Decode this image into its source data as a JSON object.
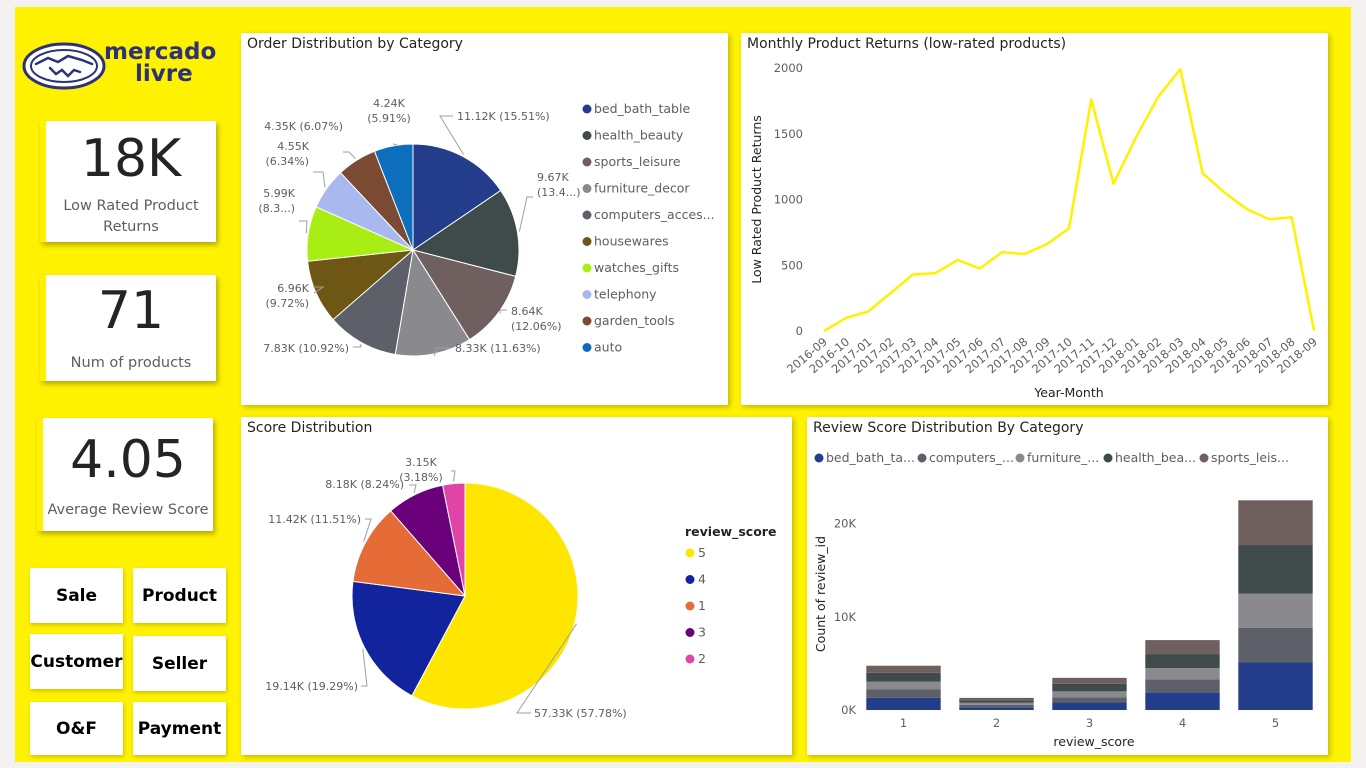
{
  "logo": {
    "line1": "mercado",
    "line2": "livre"
  },
  "kpis": {
    "returns": {
      "value": "18K",
      "label": "Low Rated Product Returns"
    },
    "products": {
      "value": "71",
      "label": "Num of products"
    },
    "score": {
      "value": "4.05",
      "label": "Average Review Score"
    }
  },
  "nav": [
    "Sale",
    "Product",
    "Customer",
    "Seller",
    "O&F",
    "Payment"
  ],
  "titles": {
    "order": "Order Distribution by Category",
    "returns": "Monthly Product Returns (low-rated products)",
    "score": "Score Distribution",
    "review": "Review Score Distribution By Category"
  },
  "chart_data": [
    {
      "id": "order",
      "type": "pie",
      "title": "Order Distribution by Category",
      "slices": [
        {
          "name": "bed_bath_table",
          "value": 11.12,
          "label": "11.12K (15.51%)",
          "color": "#233d8a"
        },
        {
          "name": "health_beauty",
          "value": 9.67,
          "label": "9.67K (13.4...)",
          "color": "#3f4a4a"
        },
        {
          "name": "sports_leisure",
          "value": 8.64,
          "label": "8.64K (12.06%)",
          "color": "#6f5f5f"
        },
        {
          "name": "furniture_decor",
          "value": 8.33,
          "label": "8.33K (11.63%)",
          "color": "#8a8a8e"
        },
        {
          "name": "computers_acces...",
          "value": 7.83,
          "label": "7.83K (10.92%)",
          "color": "#5d6068"
        },
        {
          "name": "housewares",
          "value": 6.96,
          "label": "6.96K (9.72%)",
          "color": "#6e5615"
        },
        {
          "name": "watches_gifts",
          "value": 5.99,
          "label": "5.99K (8.3...)",
          "color": "#a8ee14"
        },
        {
          "name": "telephony",
          "value": 4.55,
          "label": "4.55K (6.34%)",
          "color": "#a9b8ef"
        },
        {
          "name": "garden_tools",
          "value": 4.35,
          "label": "4.35K (6.07%)",
          "color": "#7b4a32"
        },
        {
          "name": "auto",
          "value": 4.24,
          "label": "4.24K (5.91%)",
          "color": "#0d6ebd"
        }
      ]
    },
    {
      "id": "returns",
      "type": "line",
      "title": "Monthly Product Returns (low-rated products)",
      "xlabel": "Year-Month",
      "ylabel": "Low Rated Product Returns",
      "ylim": [
        0,
        2000
      ],
      "yticks": [
        "0",
        "500",
        "1000",
        "1500",
        "2000"
      ],
      "x": [
        "2016-09",
        "2016-10",
        "2017-01",
        "2017-02",
        "2017-03",
        "2017-04",
        "2017-05",
        "2017-06",
        "2017-07",
        "2017-08",
        "2017-09",
        "2017-10",
        "2017-11",
        "2017-12",
        "2018-01",
        "2018-02",
        "2018-03",
        "2018-04",
        "2018-05",
        "2018-06",
        "2018-07",
        "2018-08",
        "2018-09"
      ],
      "values": [
        0,
        100,
        150,
        290,
        430,
        440,
        540,
        475,
        600,
        585,
        660,
        780,
        1760,
        1120,
        1470,
        1780,
        1990,
        1200,
        1050,
        925,
        850,
        865,
        5
      ],
      "color": "#fff200"
    },
    {
      "id": "score",
      "type": "pie",
      "title": "Score Distribution",
      "legend_title": "review_score",
      "slices": [
        {
          "name": "5",
          "value": 57.33,
          "label": "57.33K (57.78%)",
          "color": "#fee600"
        },
        {
          "name": "4",
          "value": 19.14,
          "label": "19.14K (19.29%)",
          "color": "#12239e"
        },
        {
          "name": "1",
          "value": 11.42,
          "label": "11.42K (11.51%)",
          "color": "#e66c37"
        },
        {
          "name": "3",
          "value": 8.18,
          "label": "8.18K (8.24%)",
          "color": "#6b007b"
        },
        {
          "name": "2",
          "value": 3.15,
          "label": "3.15K (3.18%)",
          "color": "#e044a7"
        }
      ]
    },
    {
      "id": "review",
      "type": "bar",
      "stacked": true,
      "title": "Review Score Distribution By Category",
      "xlabel": "review_score",
      "ylabel": "Count of review_id",
      "categories": [
        "1",
        "2",
        "3",
        "4",
        "5"
      ],
      "ylim": [
        0,
        25000
      ],
      "yticks": [
        "0K",
        "10K",
        "20K"
      ],
      "legend": [
        "bed_bath_ta...",
        "computers_...",
        "furniture_...",
        "health_bea...",
        "sports_leis..."
      ],
      "series": [
        {
          "name": "bed_bath_table",
          "color": "#233d8a",
          "values": [
            1300,
            300,
            800,
            1900,
            5100
          ]
        },
        {
          "name": "computers_accessories",
          "color": "#5d6068",
          "values": [
            900,
            250,
            550,
            1400,
            3700
          ]
        },
        {
          "name": "furniture_decor",
          "color": "#8a8a8e",
          "values": [
            850,
            250,
            650,
            1200,
            3700
          ]
        },
        {
          "name": "health_beauty",
          "color": "#3f4a4a",
          "values": [
            950,
            250,
            800,
            1500,
            5200
          ]
        },
        {
          "name": "sports_leisure",
          "color": "#6f5f5f",
          "values": [
            750,
            250,
            650,
            1500,
            4800
          ]
        }
      ]
    }
  ]
}
